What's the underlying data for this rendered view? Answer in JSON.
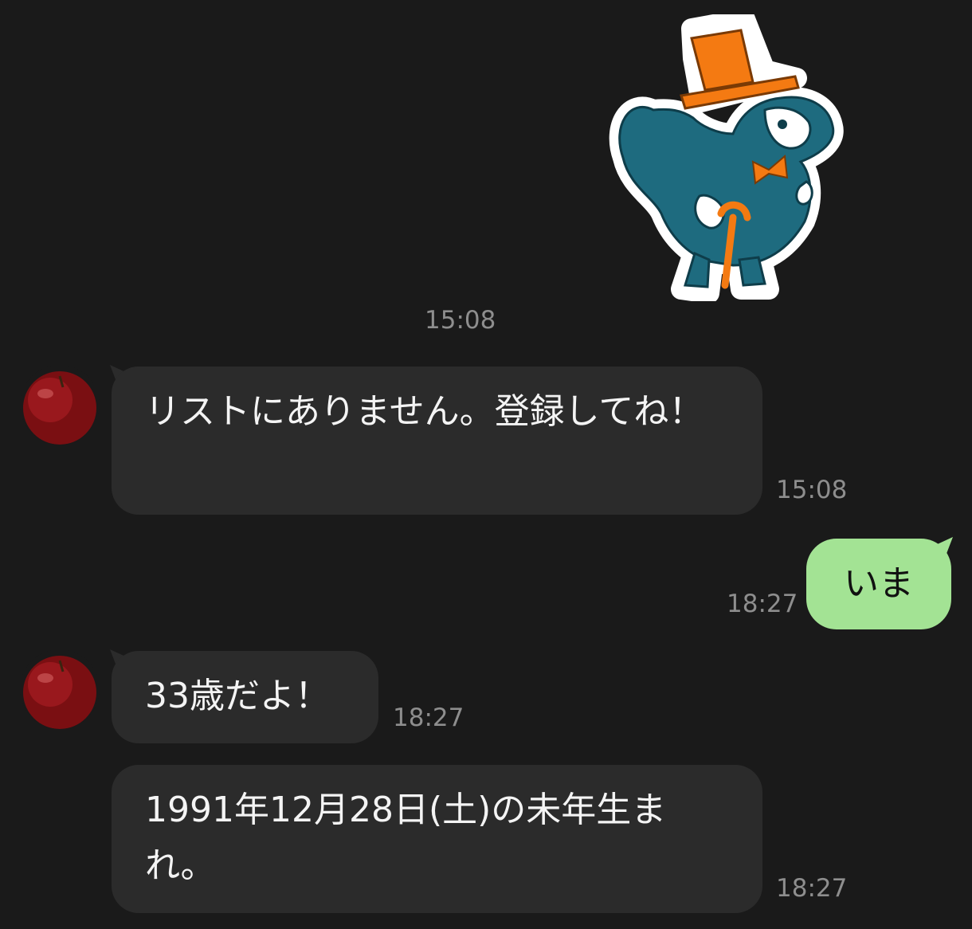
{
  "messages": [
    {
      "type": "sticker",
      "sender": "me",
      "sticker_name": "dodo-top-hat-sticker",
      "time": "15:08"
    },
    {
      "type": "text",
      "sender": "friend",
      "text": "リストにありません。登録してね！",
      "time": "15:08"
    },
    {
      "type": "text",
      "sender": "me",
      "text": "いま",
      "time": "18:27"
    },
    {
      "type": "text",
      "sender": "friend",
      "text": "33歳だよ！",
      "time": "18:27"
    },
    {
      "type": "text",
      "sender": "friend",
      "text": "1991年12月28日(土)の未年生まれ。",
      "time": "18:27"
    }
  ],
  "colors": {
    "background": "#1a1a1a",
    "incoming_bubble": "#2b2b2b",
    "outgoing_bubble": "#a3e394",
    "timestamp": "#8e8e8e"
  },
  "avatar_icon": "apple-avatar"
}
